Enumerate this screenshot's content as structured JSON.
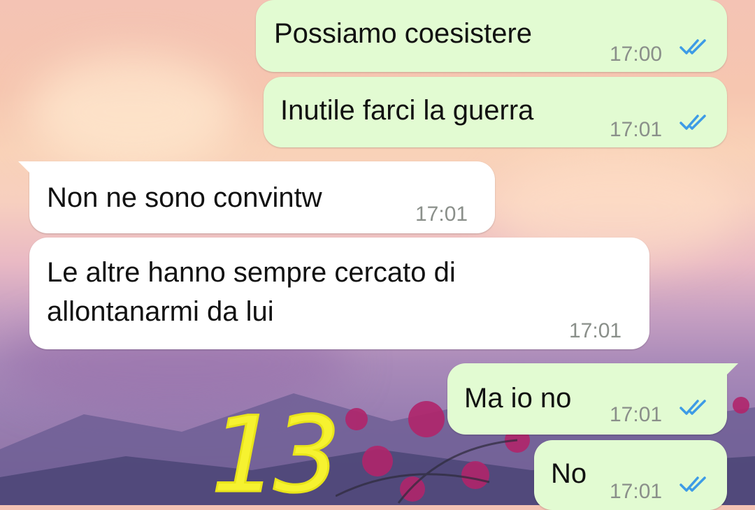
{
  "colors": {
    "outgoing_bubble": "#e2fbd2",
    "incoming_bubble": "#ffffff",
    "read_ticks": "#3d9be6",
    "marker": "#f6f230"
  },
  "messages": [
    {
      "direction": "outgoing",
      "text": "Possiamo coesistere",
      "time": "17:00",
      "status": "read"
    },
    {
      "direction": "outgoing",
      "text": "Inutile farci la guerra",
      "time": "17:01",
      "status": "read"
    },
    {
      "direction": "incoming",
      "text": "Non ne sono convintw",
      "time": "17:01"
    },
    {
      "direction": "incoming",
      "lines": [
        "Le altre hanno sempre cercato di",
        "allontanarmi da lui"
      ],
      "time": "17:01"
    },
    {
      "direction": "outgoing",
      "text": "Ma io no",
      "time": "17:01",
      "status": "read"
    },
    {
      "direction": "outgoing",
      "text": "No",
      "time": "17:01",
      "status": "read"
    }
  ],
  "annotation": {
    "text": "13",
    "style": "handwritten-yellow"
  }
}
